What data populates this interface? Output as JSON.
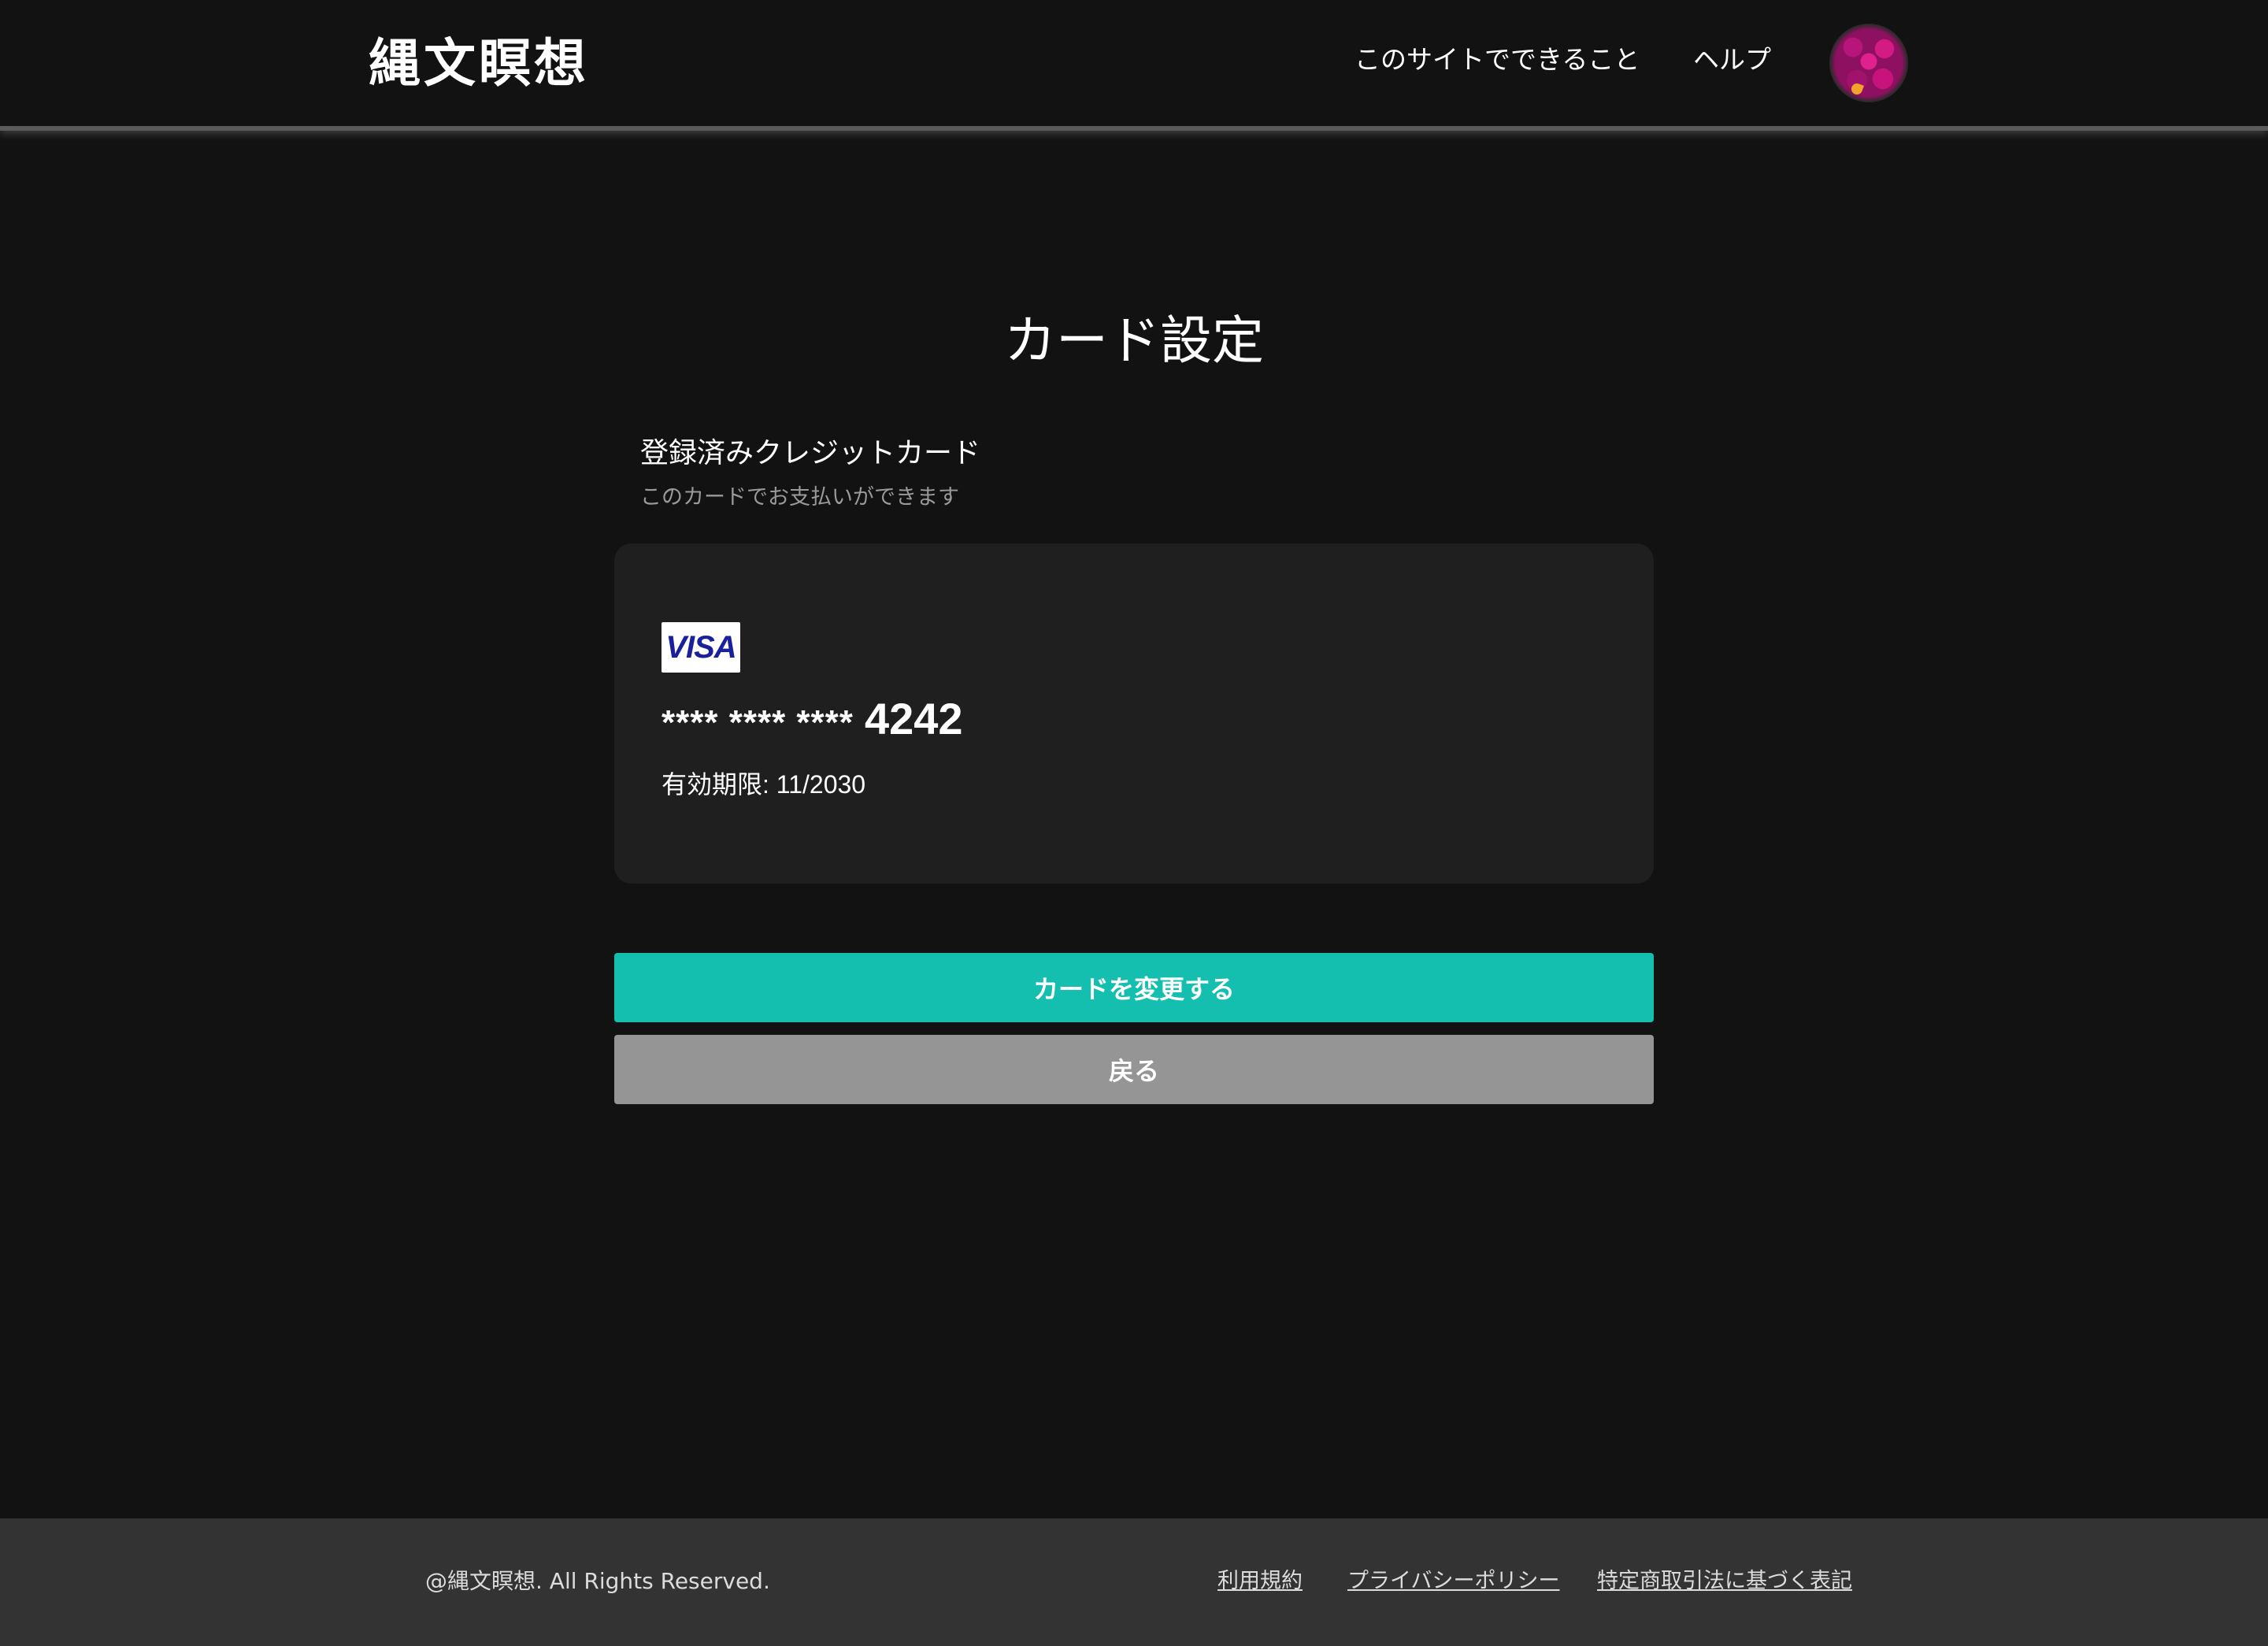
{
  "header": {
    "logo": "縄文瞑想",
    "nav": {
      "features": "このサイトでできること",
      "help": "ヘルプ"
    }
  },
  "main": {
    "title": "カード設定",
    "section_title": "登録済みクレジットカード",
    "section_subtitle": "このカードでお支払いができます",
    "card": {
      "brand": "VISA",
      "masked": "**** **** ****",
      "last4": "4242",
      "expiry": "有効期限: 11/2030"
    },
    "buttons": {
      "change": "カードを変更する",
      "back": "戻る"
    }
  },
  "footer": {
    "copyright": "@縄文瞑想. All Rights Reserved.",
    "links": {
      "terms": "利用規約",
      "privacy": "プライバシーポリシー",
      "legal": "特定商取引法に基づく表記"
    }
  },
  "colors": {
    "background": "#121212",
    "card_panel": "#1f1f1f",
    "primary_button": "#14bfb0",
    "secondary_button": "#969596",
    "footer": "#333333"
  }
}
